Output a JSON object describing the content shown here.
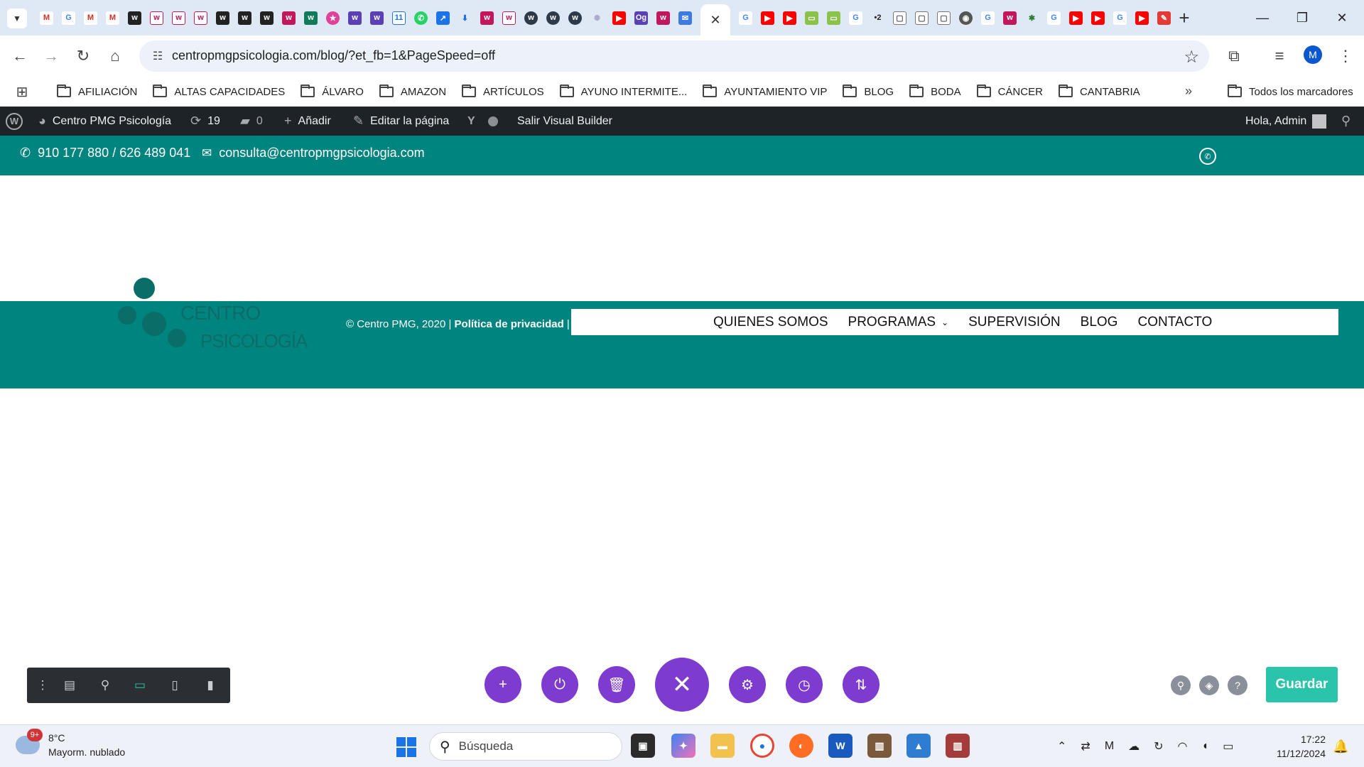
{
  "browser": {
    "url": "centropmgpsicologia.com/blog/?et_fb=1&PageSpeed=off",
    "active_tab_close": "✕",
    "new_tab": "+",
    "window_controls": {
      "minimize": "—",
      "restore": "❐",
      "close": "✕"
    },
    "profile_initial": "M"
  },
  "bookmarks": {
    "items": [
      "AFILIACIÓN",
      "ALTAS CAPACIDADES",
      "ÁLVARO",
      "AMAZON",
      "ARTÍCULOS",
      "AYUNO INTERMITE...",
      "AYUNTAMIENTO VIP",
      "BLOG",
      "BODA",
      "CÁNCER",
      "CANTABRIA"
    ],
    "more": "»",
    "all_bookmarks": "Todos los marcadores"
  },
  "wp_admin_bar": {
    "site_name": "Centro PMG Psicología",
    "updates_count": "19",
    "comments_count": "0",
    "add_new": "Añadir",
    "edit_page": "Editar la página",
    "exit_builder": "Salir Visual Builder",
    "greeting": "Hola, Admin"
  },
  "site": {
    "phone": "910 177 880 / 626 489 041",
    "email": "consulta@centropmgpsicologia.com",
    "logo_line1": "CENTRO",
    "logo_line2": "PSICOLOGÍA",
    "copyright": "© Centro PMG, 2020 |",
    "privacy_link": "Política de privacidad",
    "copyright_sep": "|",
    "menu": [
      "QUIENES SOMOS",
      "PROGRAMAS",
      "SUPERVISIÓN",
      "BLOG",
      "CONTACTO"
    ]
  },
  "builder": {
    "save_label": "Guardar"
  },
  "taskbar": {
    "weather_badge": "9+",
    "temperature": "8°C",
    "weather_desc": "Mayorm. nublado",
    "search_placeholder": "Búsqueda",
    "time": "17:22",
    "date": "11/12/2024"
  },
  "colors": {
    "site_teal": "#00847f",
    "wp_bar": "#1d2327",
    "divi_purple": "#7e3bd0",
    "save_green": "#29c4a9"
  }
}
